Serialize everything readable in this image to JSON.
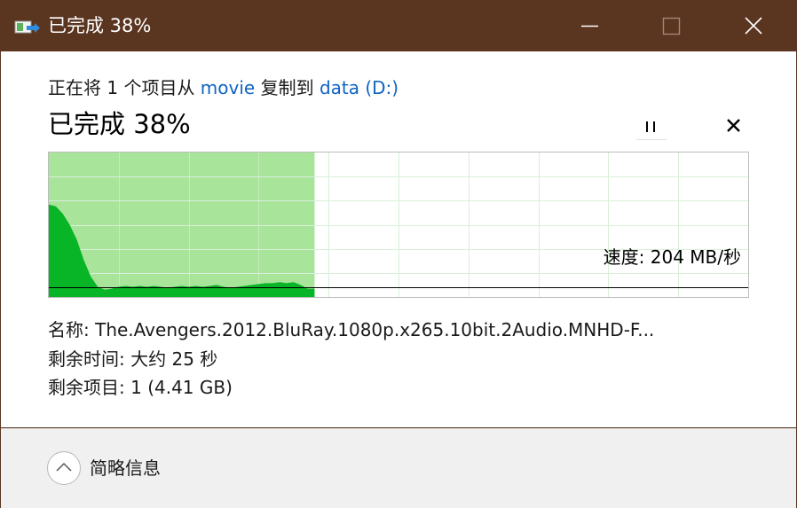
{
  "window": {
    "title": "已完成 38%",
    "icon": "file-copy-icon",
    "controls": [
      "minimize-icon",
      "maximize-icon",
      "close-icon"
    ]
  },
  "copy": {
    "prefix": "正在将 1 个项目从 ",
    "source": "movie",
    "middle": " 复制到 ",
    "destination": "data (D:)"
  },
  "progress": {
    "label": "已完成 38%",
    "percent": 38
  },
  "speed": {
    "label": "速度: 204 MB/秒",
    "value_mb_s": 204
  },
  "info": {
    "name_label": "名称:",
    "name_value": "The.Avengers.2012.BluRay.1080p.x265.10bit.2Audio.MNHD-F...",
    "time_label": "剩余时间:",
    "time_value": "大约 25 秒",
    "items_label": "剩余项目:",
    "items_value": "1 (4.41 GB)"
  },
  "footer": {
    "details_label": "简略信息"
  },
  "colors": {
    "titlebar": "#5a3520",
    "progress_fill": "#a8e49a",
    "speed_fill": "#08b526",
    "link": "#0f63c2"
  },
  "chart_data": {
    "type": "area",
    "title": "",
    "xlabel": "",
    "ylabel": "",
    "x_progress_percent": [
      0,
      1,
      2,
      3,
      4,
      5,
      6,
      7,
      8,
      9,
      10,
      11,
      12,
      13,
      14,
      15,
      16,
      17,
      18,
      19,
      20,
      21,
      22,
      23,
      24,
      25,
      26,
      27,
      28,
      29,
      30,
      31,
      32,
      33,
      34,
      35,
      36,
      37,
      38
    ],
    "relative_speed": [
      1.0,
      0.98,
      0.9,
      0.78,
      0.62,
      0.4,
      0.22,
      0.11,
      0.08,
      0.09,
      0.11,
      0.12,
      0.11,
      0.12,
      0.11,
      0.12,
      0.11,
      0.1,
      0.11,
      0.12,
      0.11,
      0.12,
      0.11,
      0.12,
      0.13,
      0.11,
      0.1,
      0.11,
      0.12,
      0.13,
      0.14,
      0.15,
      0.15,
      0.16,
      0.15,
      0.16,
      0.13,
      0.09,
      0.09
    ],
    "current_speed_level": 0.11
  }
}
